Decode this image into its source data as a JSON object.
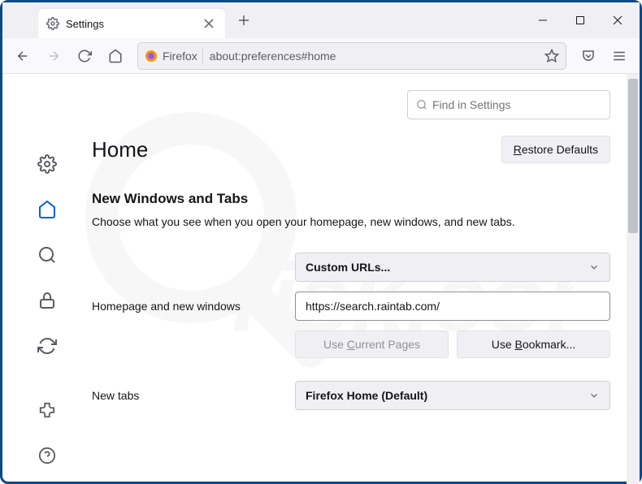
{
  "tab": {
    "title": "Settings"
  },
  "urlbar": {
    "context": "Firefox",
    "address": "about:preferences#home"
  },
  "search": {
    "placeholder": "Find in Settings"
  },
  "page": {
    "title": "Home",
    "restore_defaults": "Restore Defaults",
    "section_title": "New Windows and Tabs",
    "section_desc": "Choose what you see when you open your homepage, new windows, and new tabs."
  },
  "homepage": {
    "label": "Homepage and new windows",
    "select_value": "Custom URLs...",
    "url_value": "https://search.raintab.com/",
    "use_current": "Use Current Pages",
    "use_bookmark": "Use Bookmark..."
  },
  "newtabs": {
    "label": "New tabs",
    "select_value": "Firefox Home (Default)"
  }
}
